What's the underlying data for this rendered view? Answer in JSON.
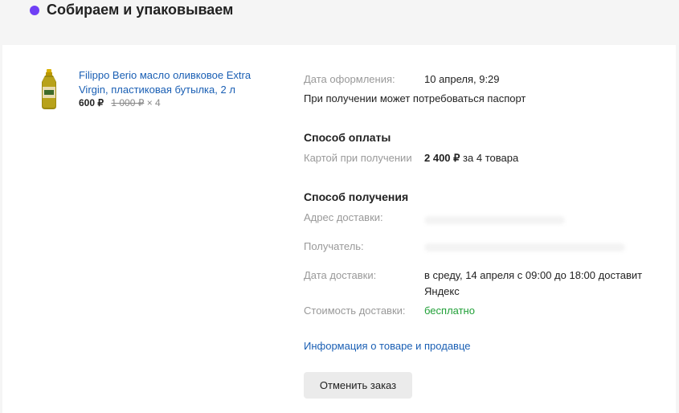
{
  "status": {
    "title": "Собираем и упаковываем",
    "dot_color": "#6f3ff5"
  },
  "product": {
    "image_icon": "olive-oil-bottle-icon",
    "title": "Filippo Berio масло оливковое Extra Virgin, пластиковая бутылка, 2 л",
    "price": "600 ₽",
    "old_price": "1 000 ₽",
    "quantity": "× 4"
  },
  "order": {
    "date_label": "Дата оформления:",
    "date_value": "10 апреля, 9:29",
    "passport_note": "При получении может потребоваться паспорт"
  },
  "payment": {
    "heading": "Способ оплаты",
    "method": "Картой при получении",
    "amount": "2 400 ₽",
    "amount_suffix": "за 4 товара"
  },
  "delivery": {
    "heading": "Способ получения",
    "address_label": "Адрес доставки:",
    "recipient_label": "Получатель:",
    "date_label": "Дата доставки:",
    "date_value_line1": "в среду, 14 апреля с 09:00 до 18:00 доставит",
    "date_value_line2": "Яндекс",
    "cost_label": "Стоимость доставки:",
    "cost_value": "бесплатно",
    "cost_color": "#21a038"
  },
  "links": {
    "info": "Информация о товаре и продавце"
  },
  "actions": {
    "cancel": "Отменить заказ"
  }
}
